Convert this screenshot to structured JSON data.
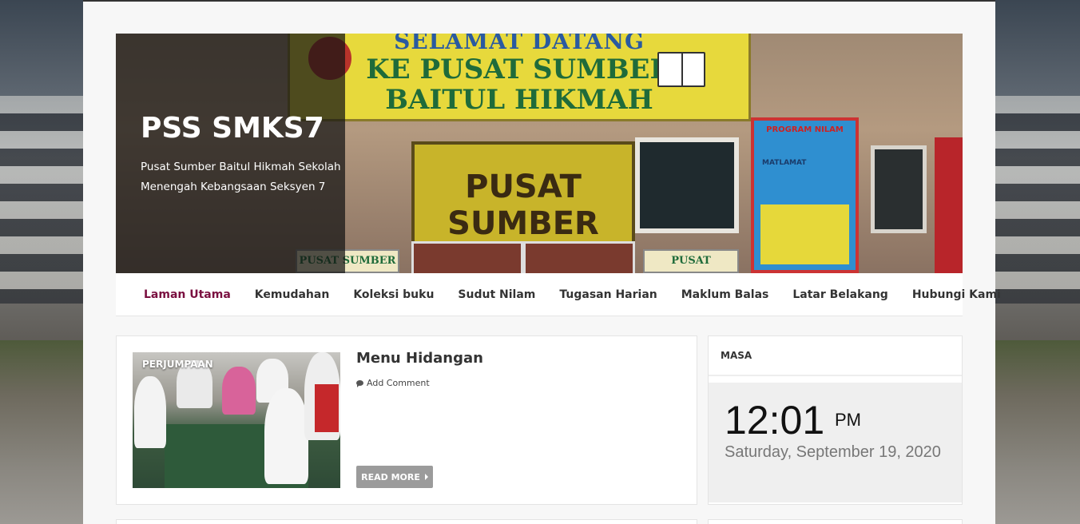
{
  "site": {
    "title": "PSS SMKS7",
    "description": "Pusat Sumber Baitul Hikmah Sekolah Menengah Kebangsaan Seksyen 7"
  },
  "banner": {
    "sign_line1": "SELAMAT DATANG",
    "sign_line2": "KE PUSAT SUMBER",
    "sign_line3": "BAITUL HIKMAH",
    "center_sign": "PUSAT SUMBER",
    "small_sign_left": "PUSAT SUMBER",
    "small_sign_right": "PUSAT SUMBER",
    "poster_heading": "PROGRAM NILAM",
    "poster_sub": "MATLAMAT"
  },
  "nav": {
    "items": [
      {
        "label": "Laman Utama",
        "active": true
      },
      {
        "label": "Kemudahan"
      },
      {
        "label": "Koleksi buku"
      },
      {
        "label": "Sudut Nilam"
      },
      {
        "label": "Tugasan Harian"
      },
      {
        "label": "Maklum Balas"
      },
      {
        "label": "Latar Belakang"
      },
      {
        "label": "Hubungi Kami"
      }
    ]
  },
  "post": {
    "category": "PERJUMPAAN",
    "title": "Menu Hidangan",
    "comment_label": "Add Comment",
    "read_more": "READ MORE"
  },
  "widget": {
    "title": "MASA",
    "time": "12:01",
    "ampm": "PM",
    "date": "Saturday, September 19, 2020"
  },
  "colors": {
    "accent": "#7a1040",
    "page_bg": "#f7f7f7",
    "button_bg": "#9b9b9b"
  },
  "icons": {
    "comment": "comment-icon",
    "read_more": "caret-right-icon"
  }
}
